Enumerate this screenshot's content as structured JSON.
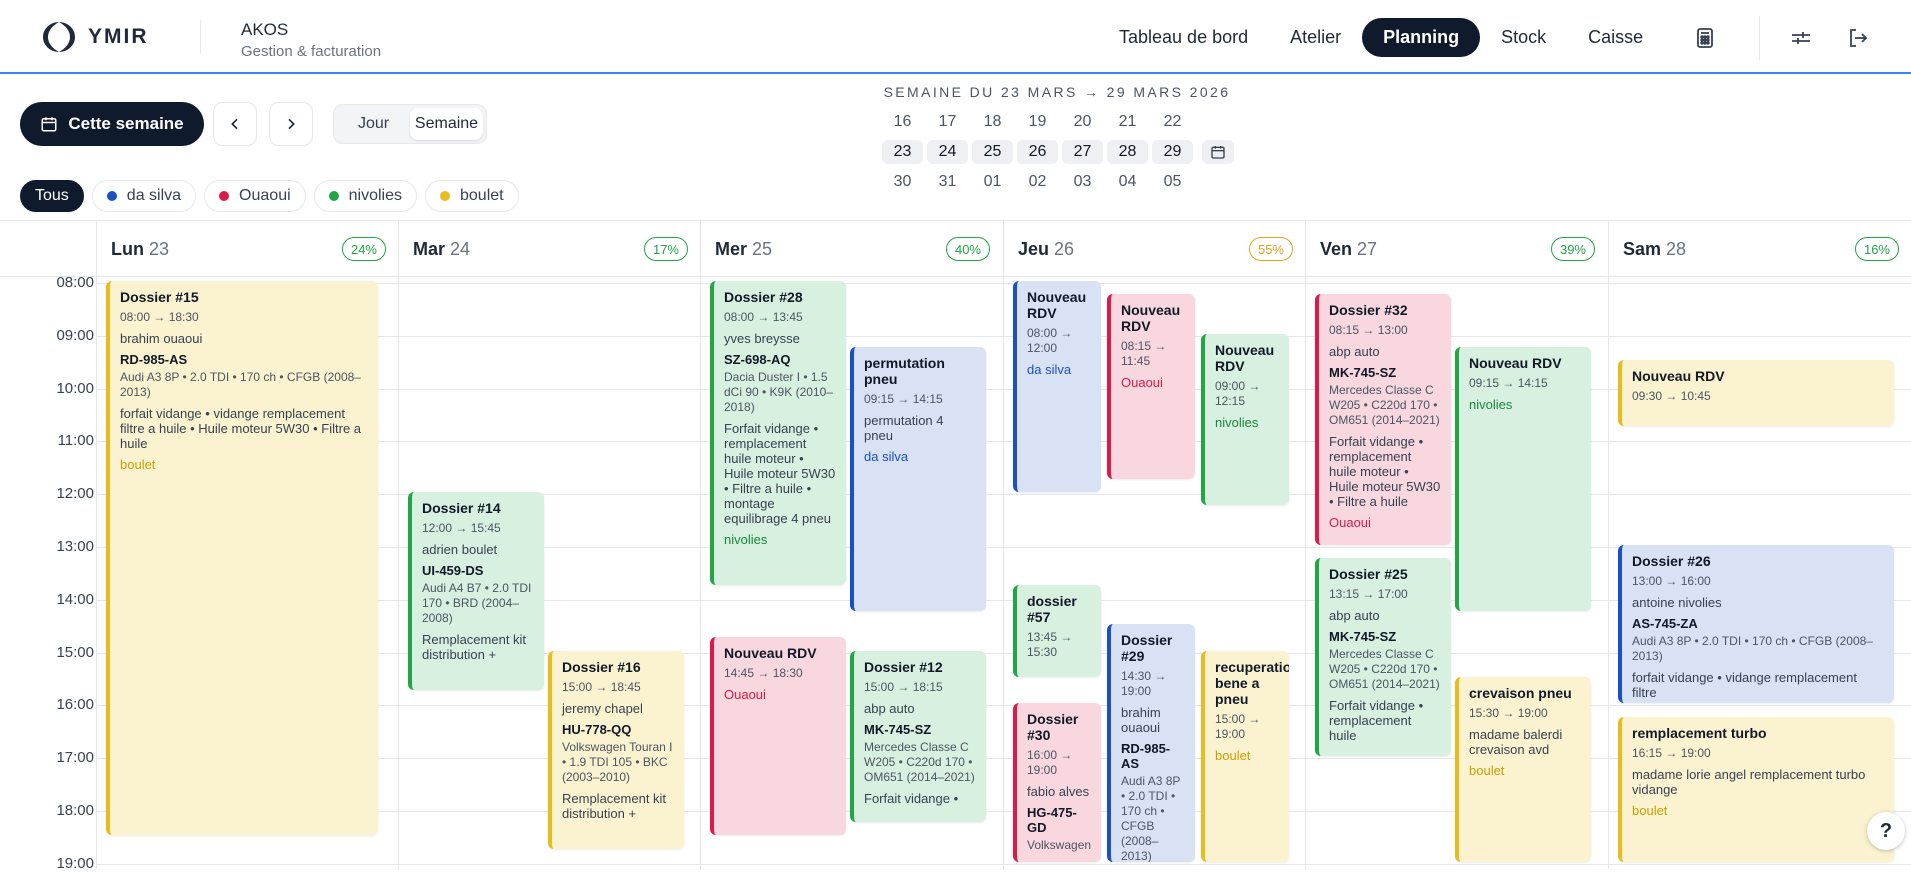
{
  "brand": {
    "logo_text": "YMIR",
    "app_name": "AKOS",
    "app_subtitle": "Gestion & facturation"
  },
  "nav": {
    "items": [
      "Tableau de bord",
      "Atelier",
      "Planning",
      "Stock",
      "Caisse"
    ],
    "active": "Planning",
    "icons": [
      "calculator-icon",
      "sliders-icon",
      "logout-icon"
    ]
  },
  "toolbar": {
    "this_week": "Cette semaine",
    "view_day": "Jour",
    "view_week": "Semaine"
  },
  "week": {
    "title": "SEMAINE DU 23 MARS → 29 MARS 2026",
    "rows": [
      [
        "16",
        "17",
        "18",
        "19",
        "20",
        "21",
        "22"
      ],
      [
        "23",
        "24",
        "25",
        "26",
        "27",
        "28",
        "29"
      ],
      [
        "30",
        "31",
        "01",
        "02",
        "03",
        "04",
        "05"
      ]
    ]
  },
  "filters": [
    {
      "label": "Tous",
      "color": ""
    },
    {
      "label": "da silva",
      "color": "#1d4fc4"
    },
    {
      "label": "Ouaoui",
      "color": "#d81b4a"
    },
    {
      "label": "nivolies",
      "color": "#22a447"
    },
    {
      "label": "boulet",
      "color": "#e6bc1e"
    }
  ],
  "days": [
    {
      "name": "Lun",
      "num": "23",
      "pct": "24%",
      "pct_color": "#22a447"
    },
    {
      "name": "Mar",
      "num": "24",
      "pct": "17%",
      "pct_color": "#22a447"
    },
    {
      "name": "Mer",
      "num": "25",
      "pct": "40%",
      "pct_color": "#22a447"
    },
    {
      "name": "Jeu",
      "num": "26",
      "pct": "55%",
      "pct_color": "#e6a21e"
    },
    {
      "name": "Ven",
      "num": "27",
      "pct": "39%",
      "pct_color": "#22a447"
    },
    {
      "name": "Sam",
      "num": "28",
      "pct": "16%",
      "pct_color": "#22a447"
    }
  ],
  "hours": [
    "08:00",
    "09:00",
    "10:00",
    "11:00",
    "12:00",
    "13:00",
    "14:00",
    "15:00",
    "16:00",
    "17:00",
    "18:00",
    "19:00"
  ],
  "events": [
    {
      "title": "Dossier #15",
      "time": "08:00 → 18:30",
      "client": "brahim ouaoui",
      "plate": "RD-985-AS",
      "vehicle": "Audi A3 8P • 2.0 TDI • 170 ch • CFGB (2008–2013)",
      "work": "forfait vidange • vidange remplacement filtre a huile • Huile moteur 5W30 • Filtre a huile",
      "tech": "boulet",
      "color": "y"
    },
    {
      "title": "Dossier #14",
      "time": "12:00 → 15:45",
      "client": "adrien boulet",
      "plate": "UI-459-DS",
      "vehicle": "Audi A4 B7 • 2.0 TDI 170 • BRD (2004–2008)",
      "work": "Remplacement kit distribution +",
      "tech": "",
      "color": "g"
    },
    {
      "title": "Dossier #16",
      "time": "15:00 → 18:45",
      "client": "jeremy chapel",
      "plate": "HU-778-QQ",
      "vehicle": "Volkswagen Touran I • 1.9 TDI 105 • BKC (2003–2010)",
      "work": "Remplacement kit distribution +",
      "tech": "",
      "color": "y"
    },
    {
      "title": "Dossier #28",
      "time": "08:00 → 13:45",
      "client": "yves breysse",
      "plate": "SZ-698-AQ",
      "vehicle": "Dacia Duster I • 1.5 dCi 90 • K9K (2010–2018)",
      "work": "Forfait vidange • remplacement huile moteur • Huile moteur 5W30 • Filtre a huile • montage equilibrage 4 pneu",
      "tech": "nivolies",
      "color": "g"
    },
    {
      "title": "permutation pneu",
      "time": "09:15 → 14:15",
      "client": "",
      "plate": "",
      "vehicle": "",
      "work": "permutation 4 pneu",
      "tech": "da silva",
      "color": "b"
    },
    {
      "title": "Nouveau RDV",
      "time": "14:45 → 18:30",
      "client": "",
      "plate": "",
      "vehicle": "",
      "work": "",
      "tech": "Ouaoui",
      "color": "r"
    },
    {
      "title": "Dossier #12",
      "time": "15:00 → 18:15",
      "client": "abp auto",
      "plate": "MK-745-SZ",
      "vehicle": "Mercedes Classe C W205 • C220d 170 • OM651 (2014–2021)",
      "work": "Forfait vidange •",
      "tech": "",
      "color": "g"
    },
    {
      "title": "Nouveau RDV",
      "time": "08:00 → 12:00",
      "client": "",
      "plate": "",
      "vehicle": "",
      "work": "",
      "tech": "da silva",
      "color": "b"
    },
    {
      "title": "Nouveau RDV",
      "time": "08:15 → 11:45",
      "client": "",
      "plate": "",
      "vehicle": "",
      "work": "",
      "tech": "Ouaoui",
      "color": "r"
    },
    {
      "title": "Nouveau RDV",
      "time": "09:00 → 12:15",
      "client": "",
      "plate": "",
      "vehicle": "",
      "work": "",
      "tech": "nivolies",
      "color": "g"
    },
    {
      "title": "dossier #57",
      "time": "13:45 → 15:30",
      "client": "",
      "plate": "",
      "vehicle": "",
      "work": "",
      "tech": "",
      "color": "g"
    },
    {
      "title": "Dossier #29",
      "time": "14:30 → 19:00",
      "client": "brahim ouaoui",
      "plate": "RD-985-AS",
      "vehicle": "Audi A3 8P • 2.0 TDI • 170 ch • CFGB (2008–2013)",
      "work": "",
      "tech": "",
      "color": "b"
    },
    {
      "title": "recuperation bene a pneu",
      "time": "15:00 → 19:00",
      "client": "",
      "plate": "",
      "vehicle": "",
      "work": "",
      "tech": "boulet",
      "color": "y"
    },
    {
      "title": "Dossier #30",
      "time": "16:00 → 19:00",
      "client": "fabio alves",
      "plate": "HG-475-GD",
      "vehicle": "Volkswagen",
      "work": "",
      "tech": "",
      "color": "r"
    },
    {
      "title": "Dossier #32",
      "time": "08:15 → 13:00",
      "client": "abp auto",
      "plate": "MK-745-SZ",
      "vehicle": "Mercedes Classe C W205 • C220d 170 • OM651 (2014–2021)",
      "work": "Forfait vidange • remplacement huile moteur • Huile moteur 5W30 • Filtre a huile",
      "tech": "Ouaoui",
      "color": "r"
    },
    {
      "title": "Nouveau RDV",
      "time": "09:15 → 14:15",
      "client": "",
      "plate": "",
      "vehicle": "",
      "work": "",
      "tech": "nivolies",
      "color": "g"
    },
    {
      "title": "Dossier #25",
      "time": "13:15 → 17:00",
      "client": "abp auto",
      "plate": "MK-745-SZ",
      "vehicle": "Mercedes Classe C W205 • C220d 170 • OM651 (2014–2021)",
      "work": "Forfait vidange • remplacement huile",
      "tech": "",
      "color": "g"
    },
    {
      "title": "crevaison pneu",
      "time": "15:30 → 19:00",
      "client": "",
      "plate": "",
      "vehicle": "",
      "work": "madame balerdi crevaison avd",
      "tech": "boulet",
      "color": "y"
    },
    {
      "title": "Nouveau RDV",
      "time": "09:30 → 10:45",
      "client": "",
      "plate": "",
      "vehicle": "",
      "work": "",
      "tech": "",
      "color": "y"
    },
    {
      "title": "Dossier #26",
      "time": "13:00 → 16:00",
      "client": "antoine nivolies",
      "plate": "AS-745-ZA",
      "vehicle": "Audi A3 8P • 2.0 TDI • 170 ch • CFGB (2008–2013)",
      "work": "forfait vidange • vidange remplacement filtre",
      "tech": "",
      "color": "b"
    },
    {
      "title": "remplacement turbo",
      "time": "16:15 → 19:00",
      "client": "",
      "plate": "",
      "vehicle": "",
      "work": "madame lorie angel remplacement turbo vidange",
      "tech": "boulet",
      "color": "y"
    }
  ],
  "help": "?"
}
